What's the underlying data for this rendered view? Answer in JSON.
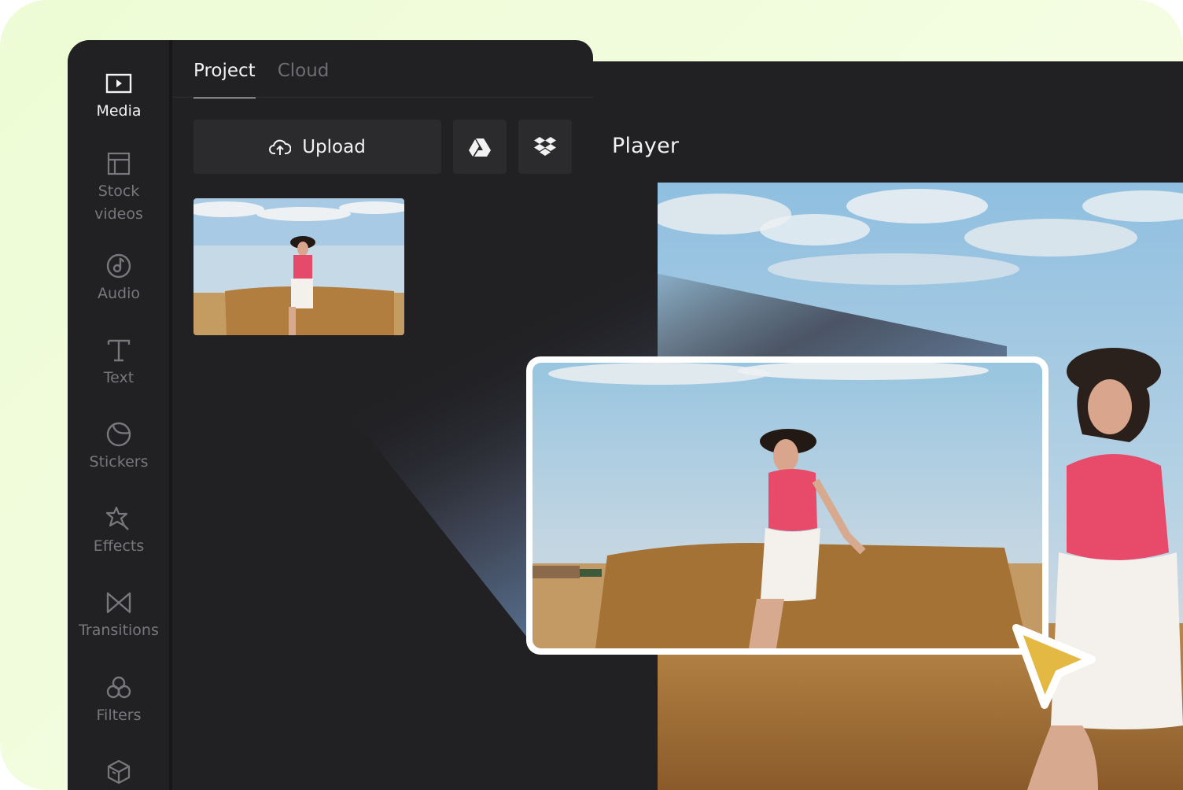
{
  "sidebar": {
    "items": [
      {
        "label": "Media",
        "icon": "media-icon",
        "active": true
      },
      {
        "label": "Stock\nvideos",
        "icon": "stock-videos-icon",
        "active": false
      },
      {
        "label": "Audio",
        "icon": "audio-icon",
        "active": false
      },
      {
        "label": "Text",
        "icon": "text-icon",
        "active": false
      },
      {
        "label": "Stickers",
        "icon": "stickers-icon",
        "active": false
      },
      {
        "label": "Effects",
        "icon": "effects-icon",
        "active": false
      },
      {
        "label": "Transitions",
        "icon": "transitions-icon",
        "active": false
      },
      {
        "label": "Filters",
        "icon": "filters-icon",
        "active": false
      },
      {
        "label": "",
        "icon": "elements-box-icon",
        "active": false
      }
    ]
  },
  "media_panel": {
    "tabs": [
      {
        "label": "Project",
        "active": true
      },
      {
        "label": "Cloud",
        "active": false
      }
    ],
    "upload_label": "Upload",
    "upload_icon": "cloud-upload-icon",
    "source_buttons": [
      {
        "icon": "google-drive-icon"
      },
      {
        "icon": "dropbox-icon"
      }
    ],
    "thumbnails": [
      {
        "description": "Woman in hat and red top leaning on hay bale in field"
      }
    ]
  },
  "player": {
    "title": "Player"
  },
  "colors": {
    "background": "#f0fcdc",
    "panel": "#212124",
    "button": "#2b2b2e",
    "text_active": "#f2f2f2",
    "text_muted": "#78787c",
    "cursor": "#e3b944"
  }
}
